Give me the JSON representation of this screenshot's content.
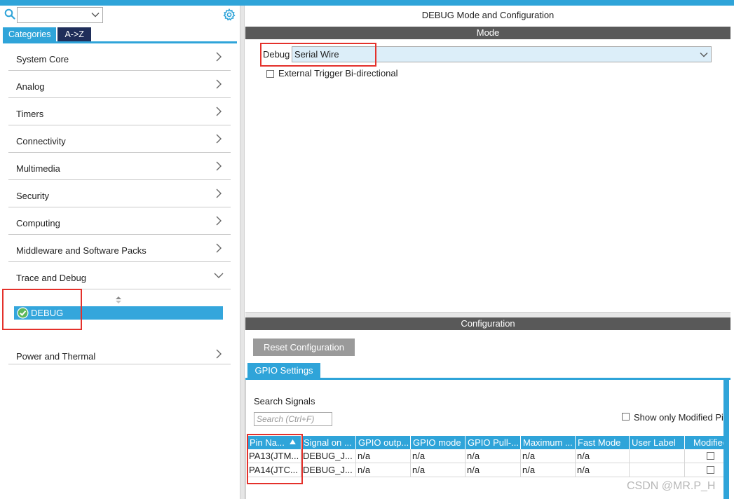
{
  "colors": {
    "accent": "#2fa4d9",
    "tab_dark": "#1f2e5a",
    "header_bar": "#595959",
    "highlight": "#e4312b",
    "ok_green": "#5cb85c"
  },
  "sidebar": {
    "search_icon": "search-icon",
    "settings_icon": "gear-icon",
    "tabs": [
      {
        "label": "Categories",
        "active": true
      },
      {
        "label": "A->Z",
        "active": false
      }
    ],
    "categories": [
      {
        "label": "System Core",
        "expanded": false
      },
      {
        "label": "Analog",
        "expanded": false
      },
      {
        "label": "Timers",
        "expanded": false
      },
      {
        "label": "Connectivity",
        "expanded": false
      },
      {
        "label": "Multimedia",
        "expanded": false
      },
      {
        "label": "Security",
        "expanded": false
      },
      {
        "label": "Computing",
        "expanded": false
      },
      {
        "label": "Middleware and Software Packs",
        "expanded": false
      },
      {
        "label": "Trace and Debug",
        "expanded": true
      }
    ],
    "selected_item": {
      "label": "DEBUG",
      "status_icon": "check-circle-icon"
    },
    "after_items": [
      {
        "label": "Power and Thermal",
        "expanded": false
      }
    ]
  },
  "main": {
    "title": "DEBUG Mode and Configuration",
    "mode_header": "Mode",
    "debug_label": "Debug",
    "debug_value": "Serial Wire",
    "external_trigger_label": "External Trigger Bi-directional",
    "external_trigger_checked": false,
    "config_header": "Configuration",
    "reset_button": "Reset Configuration",
    "settings_tab": "GPIO Settings",
    "search_signals_label": "Search Signals",
    "search_signals_placeholder": "Search (Ctrl+F)",
    "show_modified_label": "Show only Modified Pi",
    "table": {
      "columns": [
        "Pin Na...",
        "Signal on ...",
        "GPIO outp...",
        "GPIO mode",
        "GPIO Pull-...",
        "Maximum ...",
        "Fast Mode",
        "User Label",
        "Modified"
      ],
      "rows": [
        [
          "PA13(JTM...",
          "DEBUG_J...",
          "n/a",
          "n/a",
          "n/a",
          "n/a",
          "n/a",
          "",
          ""
        ],
        [
          "PA14(JTC...",
          "DEBUG_J...",
          "n/a",
          "n/a",
          "n/a",
          "n/a",
          "n/a",
          "",
          ""
        ]
      ]
    }
  },
  "watermark": "CSDN @MR.P_H"
}
